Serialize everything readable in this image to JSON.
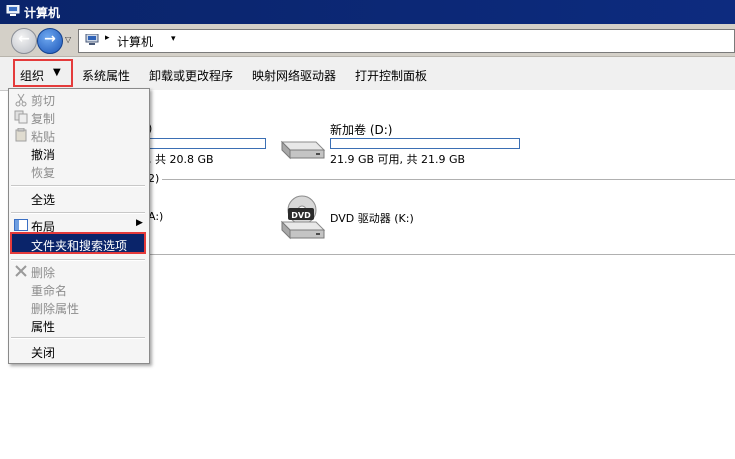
{
  "window": {
    "title": "计算机",
    "icon": "computer-icon"
  },
  "address_bar": {
    "crumb": "计算机",
    "back_icon": "back-arrow-icon",
    "forward_icon": "forward-arrow-icon"
  },
  "toolbar": {
    "organize": "组织",
    "system_properties": "系统属性",
    "uninstall": "卸载或更改程序",
    "map_drive": "映射网络驱动器",
    "control_panel": "打开控制面板"
  },
  "content": {
    "section1_fragment": ")",
    "section2_fragment": "2)",
    "c_drive_fragment": ", 共 20.8 GB",
    "d_drive": {
      "name": "新加卷 (D:)",
      "space": "21.9 GB 可用, 共 21.9 GB",
      "used_fraction": 0.0
    },
    "a_drive_fragment": "A:)",
    "dvd_drive": {
      "name": "DVD 驱动器 (K:)",
      "icon_text": "DVD"
    }
  },
  "menu": {
    "cut": "剪切",
    "copy": "复制",
    "paste": "粘贴",
    "undo": "撤消",
    "redo": "恢复",
    "select_all": "全选",
    "layout": "布局",
    "folder_options": "文件夹和搜索选项",
    "delete": "删除",
    "rename": "重命名",
    "remove_properties": "删除属性",
    "properties": "属性",
    "close": "关闭"
  },
  "colors": {
    "titlebar": "#0a246a",
    "highlight": "#0a246a",
    "annotation": "#e43b3b",
    "drive_bar_border": "#3b6fb4"
  }
}
